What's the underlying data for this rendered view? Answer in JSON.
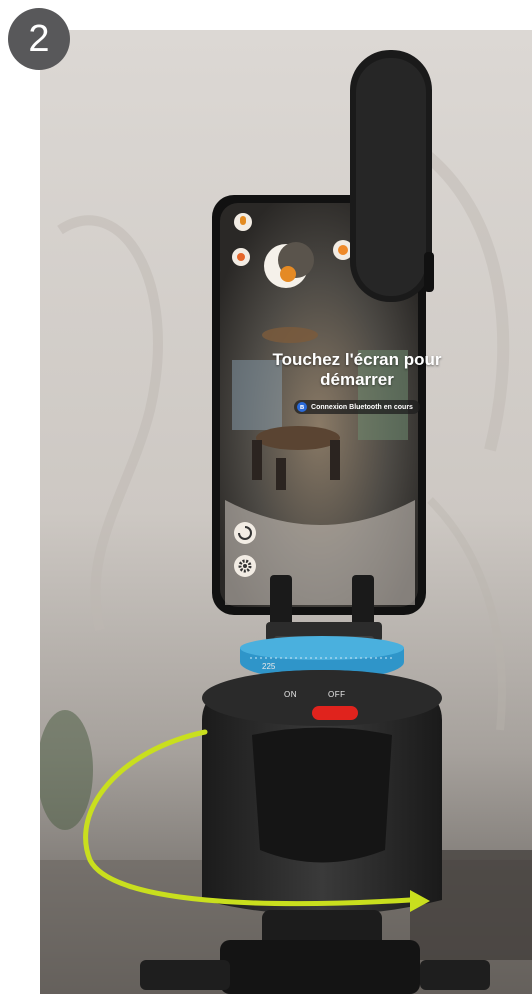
{
  "step_badge": {
    "number": "2"
  },
  "phone_screen": {
    "title": "Touchez l'écran pour démarrer",
    "bluetooth_status": "Connexion Bluetooth en cours"
  },
  "rotation_head": {
    "switch_on_label": "ON",
    "switch_off_label": "OFF",
    "dial_label": "225"
  },
  "colors": {
    "arrow": "#c9df1e",
    "dial_ring": "#2f95c9",
    "switch_button": "#e0231d",
    "badge_bg": "#58585a"
  },
  "icons": [
    "microphone-icon",
    "record-icon",
    "moon-logo-icon",
    "capture-icon",
    "rotate-icon",
    "gear-icon",
    "bluetooth-icon",
    "arrow-icon"
  ]
}
